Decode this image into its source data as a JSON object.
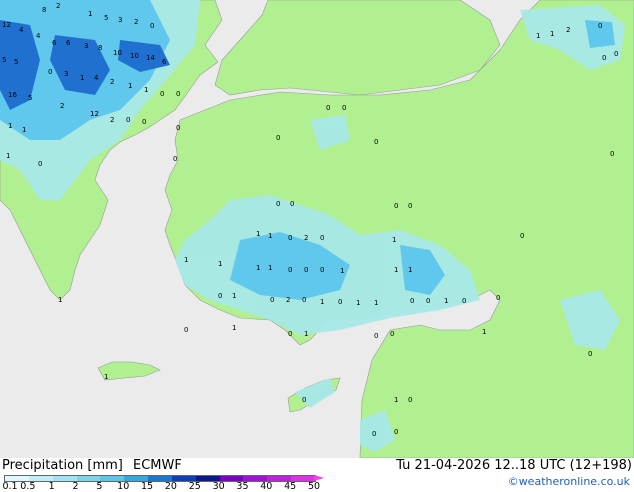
{
  "header": {
    "title": "Precipitation [mm]",
    "model": "ECMWF",
    "run_time": "Tu 21-04-2026 12..18 UTC (12+198)"
  },
  "credit": "©weatheronline.co.uk",
  "legend": {
    "ticks": [
      "0.1",
      "0.5",
      "1",
      "2",
      "5",
      "10",
      "15",
      "20",
      "25",
      "30",
      "35",
      "40",
      "45",
      "50"
    ],
    "colors": [
      "#e0f8ff",
      "#bfeef9",
      "#a0e4f2",
      "#7fd6ec",
      "#5cc6e8",
      "#36a8e0",
      "#1a78d4",
      "#0a40b8",
      "#0a1890",
      "#7a00c8",
      "#a010d8",
      "#c020e0",
      "#e030e8",
      "#f040f0"
    ]
  },
  "colors": {
    "sea": "#ebebeb",
    "land_no_rain": "#b0f090",
    "rain_light": "#a8e8e8",
    "rain_medium": "#60c8ec",
    "rain_heavy": "#2070d0"
  },
  "map": {
    "values": [
      {
        "t": "12"
      },
      {
        "t": "4"
      },
      {
        "t": "8"
      },
      {
        "t": "2"
      },
      {
        "t": "1"
      },
      {
        "t": "5"
      },
      {
        "t": "3"
      },
      {
        "t": "2"
      },
      {
        "t": "0"
      },
      {
        "t": "4"
      },
      {
        "t": "6"
      },
      {
        "t": "6"
      },
      {
        "t": "3"
      },
      {
        "t": "8"
      },
      {
        "t": "10"
      },
      {
        "t": "10"
      },
      {
        "t": "14"
      },
      {
        "t": "6"
      },
      {
        "t": "5"
      },
      {
        "t": "5"
      },
      {
        "t": "0"
      },
      {
        "t": "3"
      },
      {
        "t": "1"
      },
      {
        "t": "16"
      },
      {
        "t": "4"
      },
      {
        "t": "2"
      },
      {
        "t": "1"
      },
      {
        "t": "1"
      },
      {
        "t": "0"
      },
      {
        "t": "0"
      },
      {
        "t": "5"
      },
      {
        "t": "2"
      },
      {
        "t": "12"
      },
      {
        "t": "2"
      },
      {
        "t": "0"
      },
      {
        "t": "0"
      },
      {
        "t": "1"
      },
      {
        "t": "1"
      },
      {
        "t": "0"
      },
      {
        "t": "1"
      },
      {
        "t": "0"
      },
      {
        "t": "0"
      },
      {
        "t": "1"
      },
      {
        "t": "1"
      },
      {
        "t": "2"
      },
      {
        "t": "0"
      },
      {
        "t": "0"
      },
      {
        "t": "0"
      },
      {
        "t": "0"
      },
      {
        "t": "0"
      },
      {
        "t": "0"
      },
      {
        "t": "0"
      },
      {
        "t": "0"
      },
      {
        "t": "0"
      },
      {
        "t": "0"
      },
      {
        "t": "0"
      },
      {
        "t": "0"
      },
      {
        "t": "0"
      },
      {
        "t": "1"
      },
      {
        "t": "1"
      },
      {
        "t": "1"
      },
      {
        "t": "1"
      },
      {
        "t": "1"
      },
      {
        "t": "0"
      },
      {
        "t": "2"
      },
      {
        "t": "0"
      },
      {
        "t": "1"
      },
      {
        "t": "1"
      },
      {
        "t": "0"
      },
      {
        "t": "0"
      },
      {
        "t": "0"
      },
      {
        "t": "1"
      },
      {
        "t": "1"
      },
      {
        "t": "1"
      },
      {
        "t": "0"
      },
      {
        "t": "1"
      },
      {
        "t": "0"
      },
      {
        "t": "2"
      },
      {
        "t": "0"
      },
      {
        "t": "1"
      },
      {
        "t": "0"
      },
      {
        "t": "1"
      },
      {
        "t": "1"
      },
      {
        "t": "0"
      },
      {
        "t": "0"
      },
      {
        "t": "1"
      },
      {
        "t": "0"
      },
      {
        "t": "0"
      },
      {
        "t": "1"
      },
      {
        "t": "0"
      },
      {
        "t": "1"
      },
      {
        "t": "0"
      },
      {
        "t": "1"
      },
      {
        "t": "0"
      },
      {
        "t": "0"
      },
      {
        "t": "1"
      },
      {
        "t": "0"
      },
      {
        "t": "0"
      },
      {
        "t": "1"
      },
      {
        "t": "0"
      },
      {
        "t": "0"
      },
      {
        "t": "0"
      },
      {
        "t": "1"
      },
      {
        "t": "0"
      },
      {
        "t": "0"
      },
      {
        "t": "1"
      },
      {
        "t": "0"
      }
    ]
  }
}
